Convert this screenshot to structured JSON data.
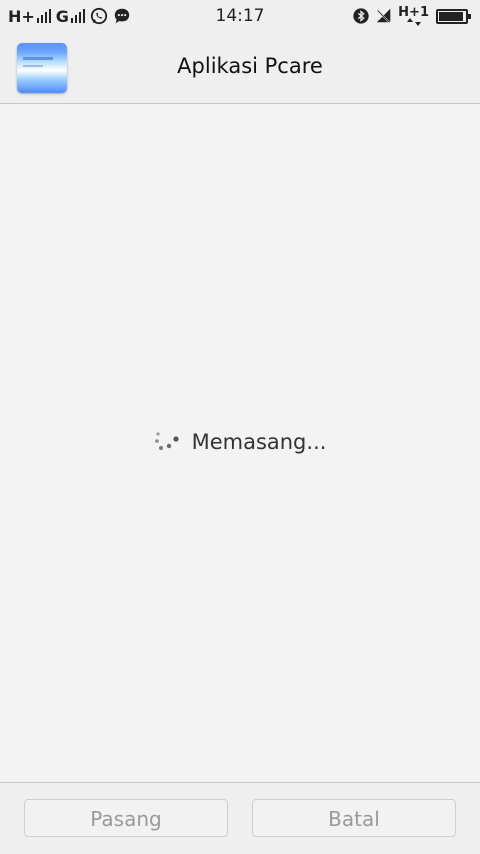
{
  "status_bar": {
    "network_1": "H+",
    "network_2": "G",
    "time": "14:17",
    "mobile_data": "H+1",
    "battery_level": 0.92
  },
  "header": {
    "title": "Aplikasi Pcare",
    "app_icon": "app-icon"
  },
  "content": {
    "loading_text": "Memasang..."
  },
  "footer": {
    "install_label": "Pasang",
    "cancel_label": "Batal"
  },
  "colors": {
    "background": "#f3f3f3",
    "bar_background": "#efefef",
    "disabled_text": "#9a9a9a"
  }
}
